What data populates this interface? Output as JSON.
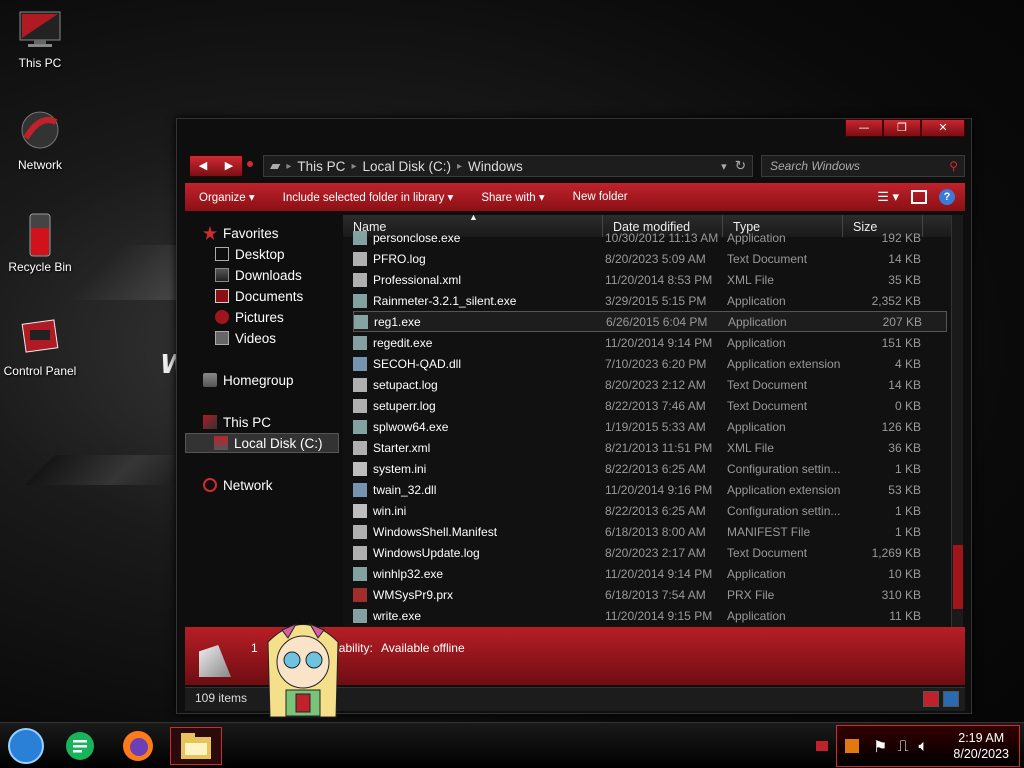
{
  "desktop": {
    "icons": [
      {
        "label": "This PC"
      },
      {
        "label": "Network"
      },
      {
        "label": "Recycle Bin"
      },
      {
        "label": "Control Panel"
      }
    ]
  },
  "window": {
    "controls": {
      "minimize": "—",
      "maximize": "❐",
      "close": "✕"
    },
    "path": [
      "This PC",
      "Local Disk (C:)",
      "Windows"
    ],
    "search_placeholder": "Search Windows",
    "toolbar": {
      "organize": "Organize ▾",
      "include": "Include selected folder in library ▾",
      "share": "Share with ▾",
      "new_folder": "New folder"
    },
    "nav": {
      "favorites": "Favorites",
      "desktop": "Desktop",
      "downloads": "Downloads",
      "documents": "Documents",
      "pictures": "Pictures",
      "videos": "Videos",
      "homegroup": "Homegroup",
      "this_pc": "This PC",
      "local_disk": "Local Disk (C:)",
      "network": "Network"
    },
    "columns": {
      "name": "Name",
      "date": "Date modified",
      "type": "Type",
      "size": "Size"
    },
    "files": [
      {
        "name": "personclose.exe",
        "date": "10/30/2012 11:13 AM",
        "type": "Application",
        "size": "192 KB"
      },
      {
        "name": "PFRO.log",
        "date": "8/20/2023 5:09 AM",
        "type": "Text Document",
        "size": "14 KB"
      },
      {
        "name": "Professional.xml",
        "date": "11/20/2014 8:53 PM",
        "type": "XML File",
        "size": "35 KB"
      },
      {
        "name": "Rainmeter-3.2.1_silent.exe",
        "date": "3/29/2015 5:15 PM",
        "type": "Application",
        "size": "2,352 KB"
      },
      {
        "name": "reg1.exe",
        "date": "6/26/2015 6:04 PM",
        "type": "Application",
        "size": "207 KB"
      },
      {
        "name": "regedit.exe",
        "date": "11/20/2014 9:14 PM",
        "type": "Application",
        "size": "151 KB"
      },
      {
        "name": "SECOH-QAD.dll",
        "date": "7/10/2023 6:20 PM",
        "type": "Application extension",
        "size": "4 KB"
      },
      {
        "name": "setupact.log",
        "date": "8/20/2023 2:12 AM",
        "type": "Text Document",
        "size": "14 KB"
      },
      {
        "name": "setuperr.log",
        "date": "8/22/2013 7:46 AM",
        "type": "Text Document",
        "size": "0 KB"
      },
      {
        "name": "splwow64.exe",
        "date": "1/19/2015 5:33 AM",
        "type": "Application",
        "size": "126 KB"
      },
      {
        "name": "Starter.xml",
        "date": "8/21/2013 11:51 PM",
        "type": "XML File",
        "size": "36 KB"
      },
      {
        "name": "system.ini",
        "date": "8/22/2013 6:25 AM",
        "type": "Configuration settin...",
        "size": "1 KB"
      },
      {
        "name": "twain_32.dll",
        "date": "11/20/2014 9:16 PM",
        "type": "Application extension",
        "size": "53 KB"
      },
      {
        "name": "win.ini",
        "date": "8/22/2013 6:25 AM",
        "type": "Configuration settin...",
        "size": "1 KB"
      },
      {
        "name": "WindowsShell.Manifest",
        "date": "6/18/2013 8:00 AM",
        "type": "MANIFEST File",
        "size": "1 KB"
      },
      {
        "name": "WindowsUpdate.log",
        "date": "8/20/2023 2:17 AM",
        "type": "Text Document",
        "size": "1,269 KB"
      },
      {
        "name": "winhlp32.exe",
        "date": "11/20/2014 9:14 PM",
        "type": "Application",
        "size": "10 KB"
      },
      {
        "name": "WMSysPr9.prx",
        "date": "6/18/2013 7:54 AM",
        "type": "PRX File",
        "size": "310 KB"
      },
      {
        "name": "write.exe",
        "date": "11/20/2014 9:15 PM",
        "type": "Application",
        "size": "11 KB"
      }
    ],
    "details": {
      "label": "Availability:",
      "value": "Available offline",
      "prefix": "1"
    },
    "status": {
      "items": "109 items"
    }
  },
  "taskbar": {
    "clock": {
      "time": "2:19 AM",
      "date": "8/20/2023"
    }
  },
  "colors": {
    "accent": "#c0222b",
    "dark": "#0e0e0e"
  }
}
